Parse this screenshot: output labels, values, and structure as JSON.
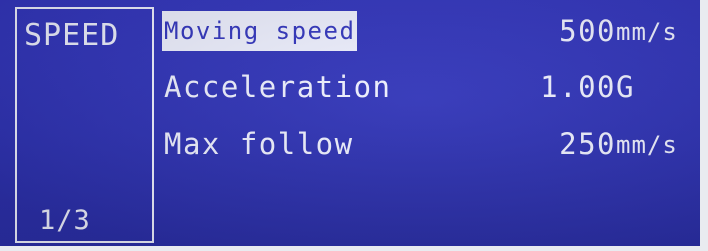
{
  "panel": {
    "title": "SPEED",
    "page": "1/3"
  },
  "settings": [
    {
      "label": "Moving speed",
      "value": "500",
      "unit": "mm/s",
      "selected": true
    },
    {
      "label": "Acceleration",
      "value": "1.00",
      "unit": "G",
      "selected": false
    },
    {
      "label": "Max follow",
      "value": "250",
      "unit": "mm/s",
      "selected": false
    }
  ],
  "colors": {
    "screen_background": "#3437bf",
    "text": "#eef0ff",
    "selection_highlight": "#eef0ff"
  }
}
